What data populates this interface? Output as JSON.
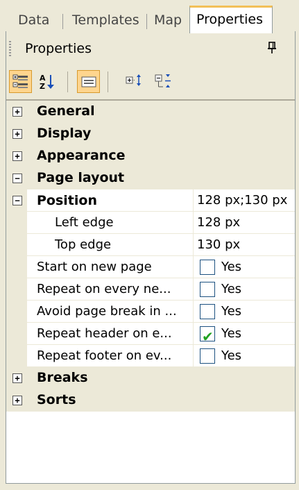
{
  "tabs": [
    {
      "label": "Data"
    },
    {
      "label": "Templates"
    },
    {
      "label": "Map"
    },
    {
      "label": "Properties"
    }
  ],
  "panel": {
    "title": "Properties",
    "pin_icon": "pin-icon"
  },
  "toolbar": {
    "buttons": [
      {
        "name": "categorized-view",
        "icon": "categorized-icon",
        "active": true
      },
      {
        "name": "alphabetical-sort",
        "icon": "sort-az-icon",
        "active": false
      },
      {
        "name": "property-pages",
        "icon": "property-pages-icon",
        "active": true
      },
      {
        "name": "expand-all",
        "icon": "expand-all-icon",
        "active": false
      },
      {
        "name": "collapse-all",
        "icon": "collapse-all-icon",
        "active": false
      }
    ]
  },
  "grid": {
    "categories_top": [
      {
        "label": "General",
        "expanded": false
      },
      {
        "label": "Display",
        "expanded": false
      },
      {
        "label": "Appearance",
        "expanded": false
      },
      {
        "label": "Page layout",
        "expanded": true
      }
    ],
    "position": {
      "label": "Position",
      "value": "128 px;130 px",
      "expanded": true
    },
    "position_children": [
      {
        "label": "Left edge",
        "value": "128 px"
      },
      {
        "label": "Top edge",
        "value": "130 px"
      }
    ],
    "checkbox_props": [
      {
        "label": "Start on new page",
        "value": "Yes",
        "checked": false
      },
      {
        "label": "Repeat on every ne...",
        "value": "Yes",
        "checked": false
      },
      {
        "label": "Avoid page break in ...",
        "value": "Yes",
        "checked": false
      },
      {
        "label": "Repeat header on e...",
        "value": "Yes",
        "checked": true
      },
      {
        "label": "Repeat footer on ev...",
        "value": "Yes",
        "checked": false
      }
    ],
    "categories_bottom": [
      {
        "label": "Breaks",
        "expanded": false
      },
      {
        "label": "Sorts",
        "expanded": false
      }
    ],
    "expand_symbol": "+",
    "collapse_symbol": "−"
  },
  "colors": {
    "active_tab_accent": "#f2c057",
    "toolbar_active": "#ffd58e",
    "chrome": "#ece9d8",
    "checkmark": "#21a121"
  }
}
